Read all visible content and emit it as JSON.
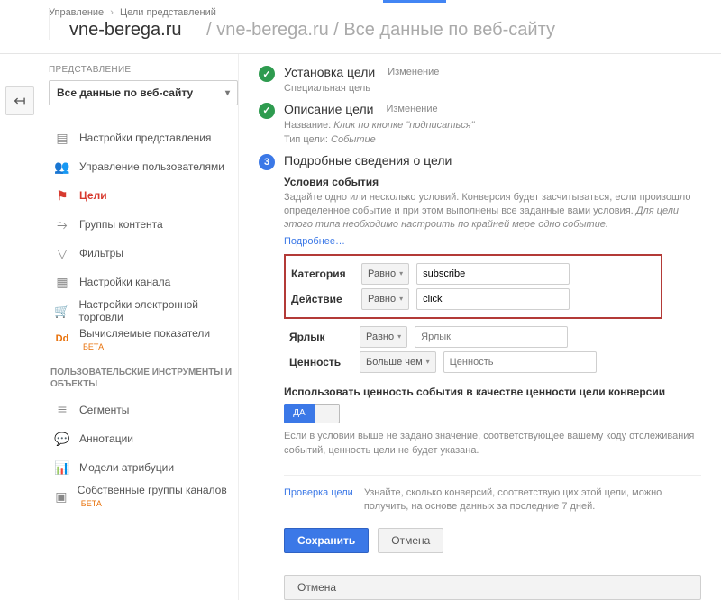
{
  "breadcrumb": {
    "item1": "Управление",
    "item2": "Цели представлений"
  },
  "title": {
    "main": "vne-berega.ru",
    "sub": " / vne-berega.ru / Все данные по веб-сайту"
  },
  "sidebar": {
    "section_label": "ПРЕДСТАВЛЕНИЕ",
    "view_select": "Все данные по веб-сайту",
    "items": [
      {
        "label": "Настройки представления"
      },
      {
        "label": "Управление пользователями"
      },
      {
        "label": "Цели"
      },
      {
        "label": "Группы контента"
      },
      {
        "label": "Фильтры"
      },
      {
        "label": "Настройки канала"
      },
      {
        "label": "Настройки электронной торговли"
      },
      {
        "label": "Вычисляемые показатели",
        "beta": "БЕТА"
      }
    ],
    "section2_label": "ПОЛЬЗОВАТЕЛЬСКИЕ ИНСТРУМЕНТЫ И ОБЪЕКТЫ",
    "items2": [
      {
        "label": "Сегменты"
      },
      {
        "label": "Аннотации"
      },
      {
        "label": "Модели атрибуции"
      },
      {
        "label": "Собственные группы каналов",
        "beta": "БЕТА"
      }
    ]
  },
  "steps": {
    "s1": {
      "title": "Установка цели",
      "action": "Изменение",
      "sub": "Специальная цель"
    },
    "s2": {
      "title": "Описание цели",
      "action": "Изменение",
      "sub1_label": "Название:",
      "sub1_val": "Клик по кнопке \"подписаться\"",
      "sub2_label": "Тип цели:",
      "sub2_val": "Событие"
    },
    "s3": {
      "num": "3",
      "title": "Подробные сведения о цели"
    }
  },
  "event": {
    "head": "Условия события",
    "desc1": "Задайте одно или несколько условий. Конверсия будет засчитываться, если произошло определенное событие и при этом выполнены все заданные вами условия.",
    "desc2": "Для цели этого типа необходимо настроить по крайней мере одно событие.",
    "more": "Подробнее…"
  },
  "cond": {
    "op_equals": "Равно",
    "op_gt": "Больше чем",
    "category": {
      "label": "Категория",
      "value": "subscribe"
    },
    "action": {
      "label": "Действие",
      "value": "click"
    },
    "label": {
      "label": "Ярлык",
      "placeholder": "Ярлык"
    },
    "value": {
      "label": "Ценность",
      "placeholder": "Ценность"
    }
  },
  "use_value": {
    "heading": "Использовать ценность события в качестве ценности цели конверсии",
    "toggle_on": "ДА",
    "note": "Если в условии выше не задано значение, соответствующее вашему коду отслеживания событий, ценность цели не будет указана."
  },
  "check": {
    "link": "Проверка цели",
    "text": "Узнайте, сколько конверсий, соответствующих этой цели, можно получить, на основе данных за последние 7 дней."
  },
  "buttons": {
    "save": "Сохранить",
    "cancel": "Отмена",
    "cancel_outer": "Отмена"
  }
}
